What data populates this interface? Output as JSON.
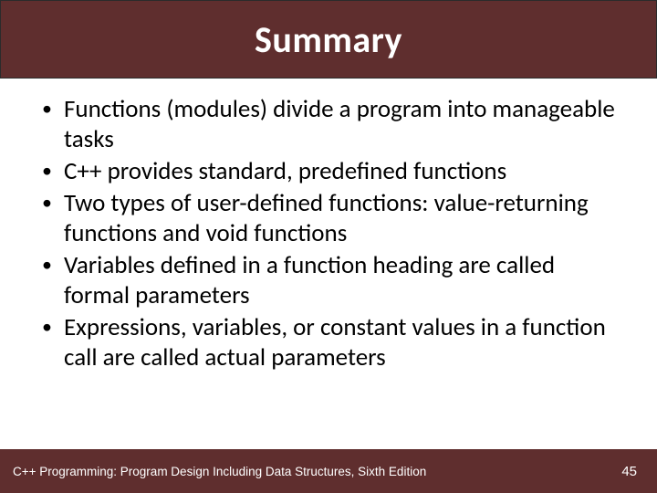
{
  "title": "Summary",
  "bullets": [
    "Functions (modules) divide a program into manageable tasks",
    "C++ provides standard, predefined functions",
    "Two types of user-defined functions: value-returning functions and void functions",
    "Variables defined in a function heading are called formal parameters",
    "Expressions, variables, or constant values in a function call are called actual parameters"
  ],
  "footer": {
    "book": "C++ Programming: Program Design Including Data Structures, Sixth Edition",
    "page": "45"
  }
}
